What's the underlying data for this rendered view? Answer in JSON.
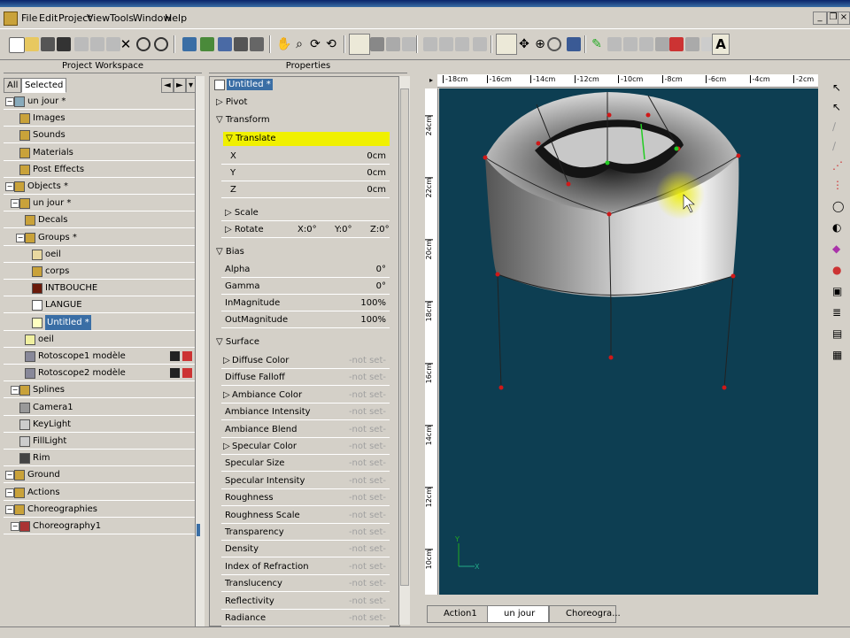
{
  "menubar": {
    "items": [
      "File",
      "Edit",
      "Project",
      "View",
      "Tools",
      "Window",
      "Help"
    ]
  },
  "workspace": {
    "title": "Project Workspace",
    "tabs": [
      "All",
      "Selected"
    ],
    "tree": [
      {
        "label": "un jour *"
      },
      {
        "label": "Images"
      },
      {
        "label": "Sounds"
      },
      {
        "label": "Materials"
      },
      {
        "label": "Post Effects"
      },
      {
        "label": "Objects *"
      },
      {
        "label": "un jour *"
      },
      {
        "label": "Decals"
      },
      {
        "label": "Groups *"
      },
      {
        "label": "oeil"
      },
      {
        "label": "corps"
      },
      {
        "label": "INTBOUCHE"
      },
      {
        "label": "LANGUE"
      },
      {
        "label": "Untitled *"
      },
      {
        "label": "oeil"
      },
      {
        "label": "Rotoscope1 modèle"
      },
      {
        "label": "Rotoscope2 modèle"
      },
      {
        "label": "Splines"
      },
      {
        "label": "Camera1"
      },
      {
        "label": "KeyLight"
      },
      {
        "label": "FillLight"
      },
      {
        "label": "Rim"
      },
      {
        "label": "Ground"
      },
      {
        "label": "Actions"
      },
      {
        "label": "Choreographies"
      },
      {
        "label": "Choreography1"
      }
    ]
  },
  "properties": {
    "title": "Properties",
    "object_name": "Untitled *",
    "pivot": "Pivot",
    "transform": "Transform",
    "translate": "Translate",
    "x_label": "X",
    "x_value": "0cm",
    "y_label": "Y",
    "y_value": "0cm",
    "z_label": "Z",
    "z_value": "0cm",
    "scale": "Scale",
    "rotate": "Rotate",
    "rotate_x": "X:0°",
    "rotate_y": "Y:0°",
    "rotate_z": "Z:0°",
    "bias": "Bias",
    "alpha": "Alpha",
    "alpha_value": "0°",
    "gamma": "Gamma",
    "gamma_value": "0°",
    "in_magnitude": "InMagnitude",
    "in_magnitude_value": "100%",
    "out_magnitude": "OutMagnitude",
    "out_magnitude_value": "100%",
    "surface": "Surface",
    "not_set": "-not set-",
    "surface_rows": [
      "Diffuse Color",
      "Diffuse Falloff",
      "Ambiance Color",
      "Ambiance Intensity",
      "Ambiance Blend",
      "Specular Color",
      "Specular Size",
      "Specular Intensity",
      "Roughness",
      "Roughness Scale",
      "Transparency",
      "Density",
      "Index of Refraction",
      "Translucency",
      "Reflectivity",
      "Radiance"
    ]
  },
  "view": {
    "ruler_top": [
      "-18cm",
      "-16cm",
      "-14cm",
      "-12cm",
      "-10cm",
      "-8cm",
      "-6cm",
      "-4cm",
      "-2cm"
    ],
    "ruler_left": [
      "24cm",
      "22cm",
      "20cm",
      "18cm",
      "16cm",
      "14cm",
      "12cm",
      "10cm"
    ],
    "bg_color": "#0d3e52",
    "axis_y": "Y",
    "axis_x": "X"
  },
  "bottom_tabs": [
    "Action1",
    "un jour",
    "Choreogra..."
  ],
  "colors": {
    "highlight_yellow": "#f0f000",
    "selection_blue": "#3a6ea5"
  }
}
